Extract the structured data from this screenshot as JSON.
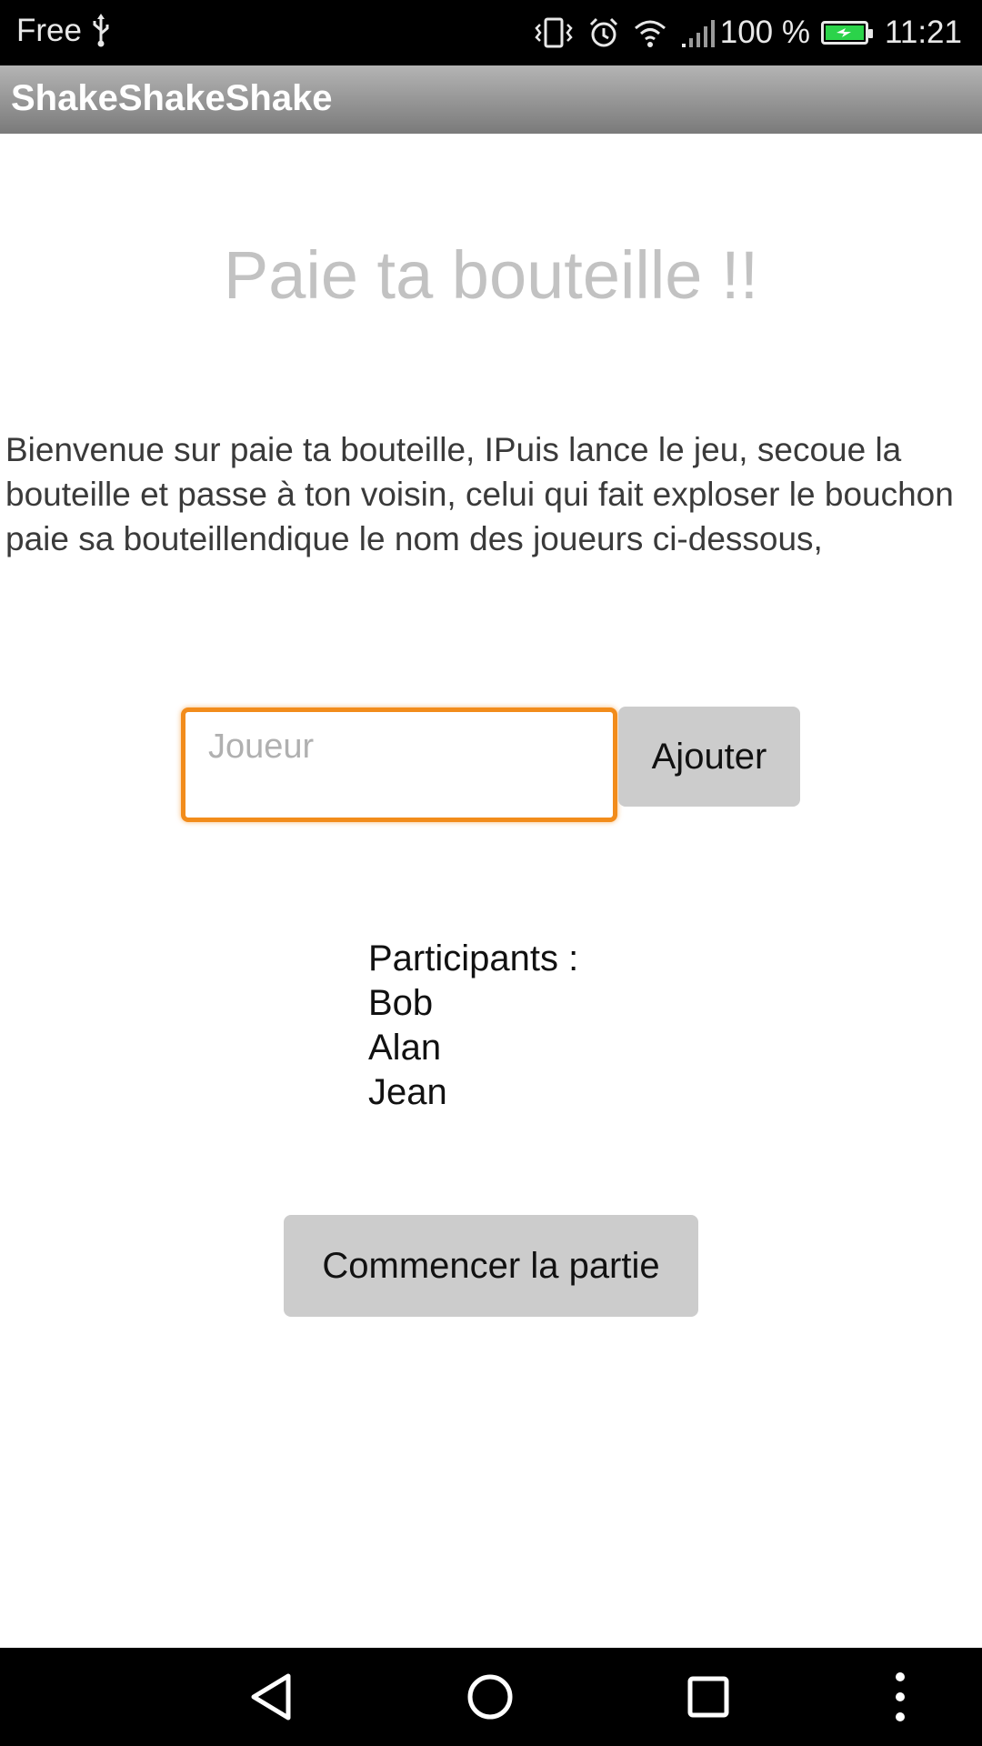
{
  "status_bar": {
    "carrier": "Free",
    "battery_percent": "100 %",
    "time": "11:21",
    "icons": [
      "usb-icon",
      "vibrate-icon",
      "alarm-icon",
      "wifi-icon",
      "signal-icon",
      "battery-icon"
    ],
    "battery_color": "#2bd34a"
  },
  "app_bar": {
    "title": "ShakeShakeShake"
  },
  "main": {
    "heading": "Paie ta bouteille !!",
    "intro": "Bienvenue sur paie ta bouteille,  IPuis lance le jeu, secoue la bouteille et passe à ton voisin, celui qui fait exploser le bouchon paie sa bouteillendique le nom des joueurs ci-dessous,",
    "player_input": {
      "placeholder": "Joueur",
      "value": ""
    },
    "add_button_label": "Ajouter",
    "participants": {
      "label": "Participants :",
      "names": [
        "Bob",
        "Alan",
        "Jean"
      ]
    },
    "start_button_label": "Commencer la partie"
  },
  "nav_bar": {
    "icons": [
      "back-icon",
      "home-icon",
      "recents-icon",
      "more-icon"
    ]
  },
  "colors": {
    "accent": "#f28c1b",
    "button_bg": "#cccccc",
    "heading_text": "#c2c2c2"
  }
}
